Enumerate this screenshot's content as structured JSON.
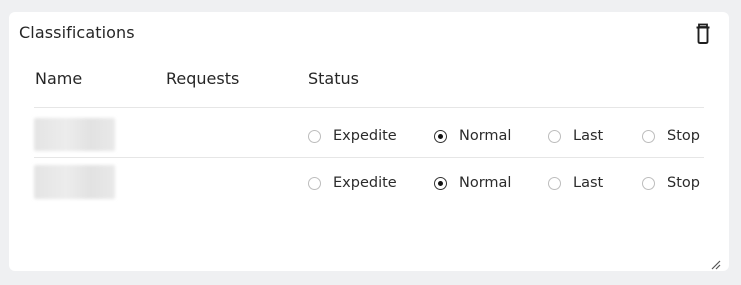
{
  "card": {
    "title": "Classifications",
    "delete_icon": "trash-icon"
  },
  "table": {
    "headers": [
      "Name",
      "Requests",
      "Status"
    ],
    "rows": [
      {
        "name": "",
        "requests": "",
        "status": "Normal",
        "options": [
          "Expedite",
          "Normal",
          "Last",
          "Stop"
        ]
      },
      {
        "name": "",
        "requests": "",
        "status": "Normal",
        "options": [
          "Expedite",
          "Normal",
          "Last",
          "Stop"
        ]
      }
    ]
  },
  "colors": {
    "background": "#eff0f2",
    "card": "#ffffff",
    "divider": "#e6e6e6"
  }
}
